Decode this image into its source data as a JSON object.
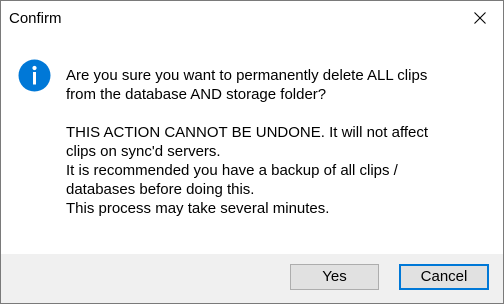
{
  "window": {
    "title": "Confirm",
    "close_icon": "close-icon"
  },
  "icon": {
    "name": "info-icon",
    "glyph": "i",
    "color": "#0078d7"
  },
  "message": {
    "lines": [
      "Are you sure you want to permanently delete ALL clips",
      "from the database AND storage folder?",
      "",
      "THIS ACTION CANNOT BE UNDONE.  It will not affect",
      "clips on sync'd servers.",
      "It is recommended you have a backup of all clips /",
      "databases before doing this.",
      "This process may take several minutes."
    ]
  },
  "buttons": {
    "yes_label": "Yes",
    "cancel_label": "Cancel"
  },
  "colors": {
    "accent": "#0078d7",
    "footer_bg": "#f0f0f0",
    "button_bg": "#e1e1e1"
  }
}
